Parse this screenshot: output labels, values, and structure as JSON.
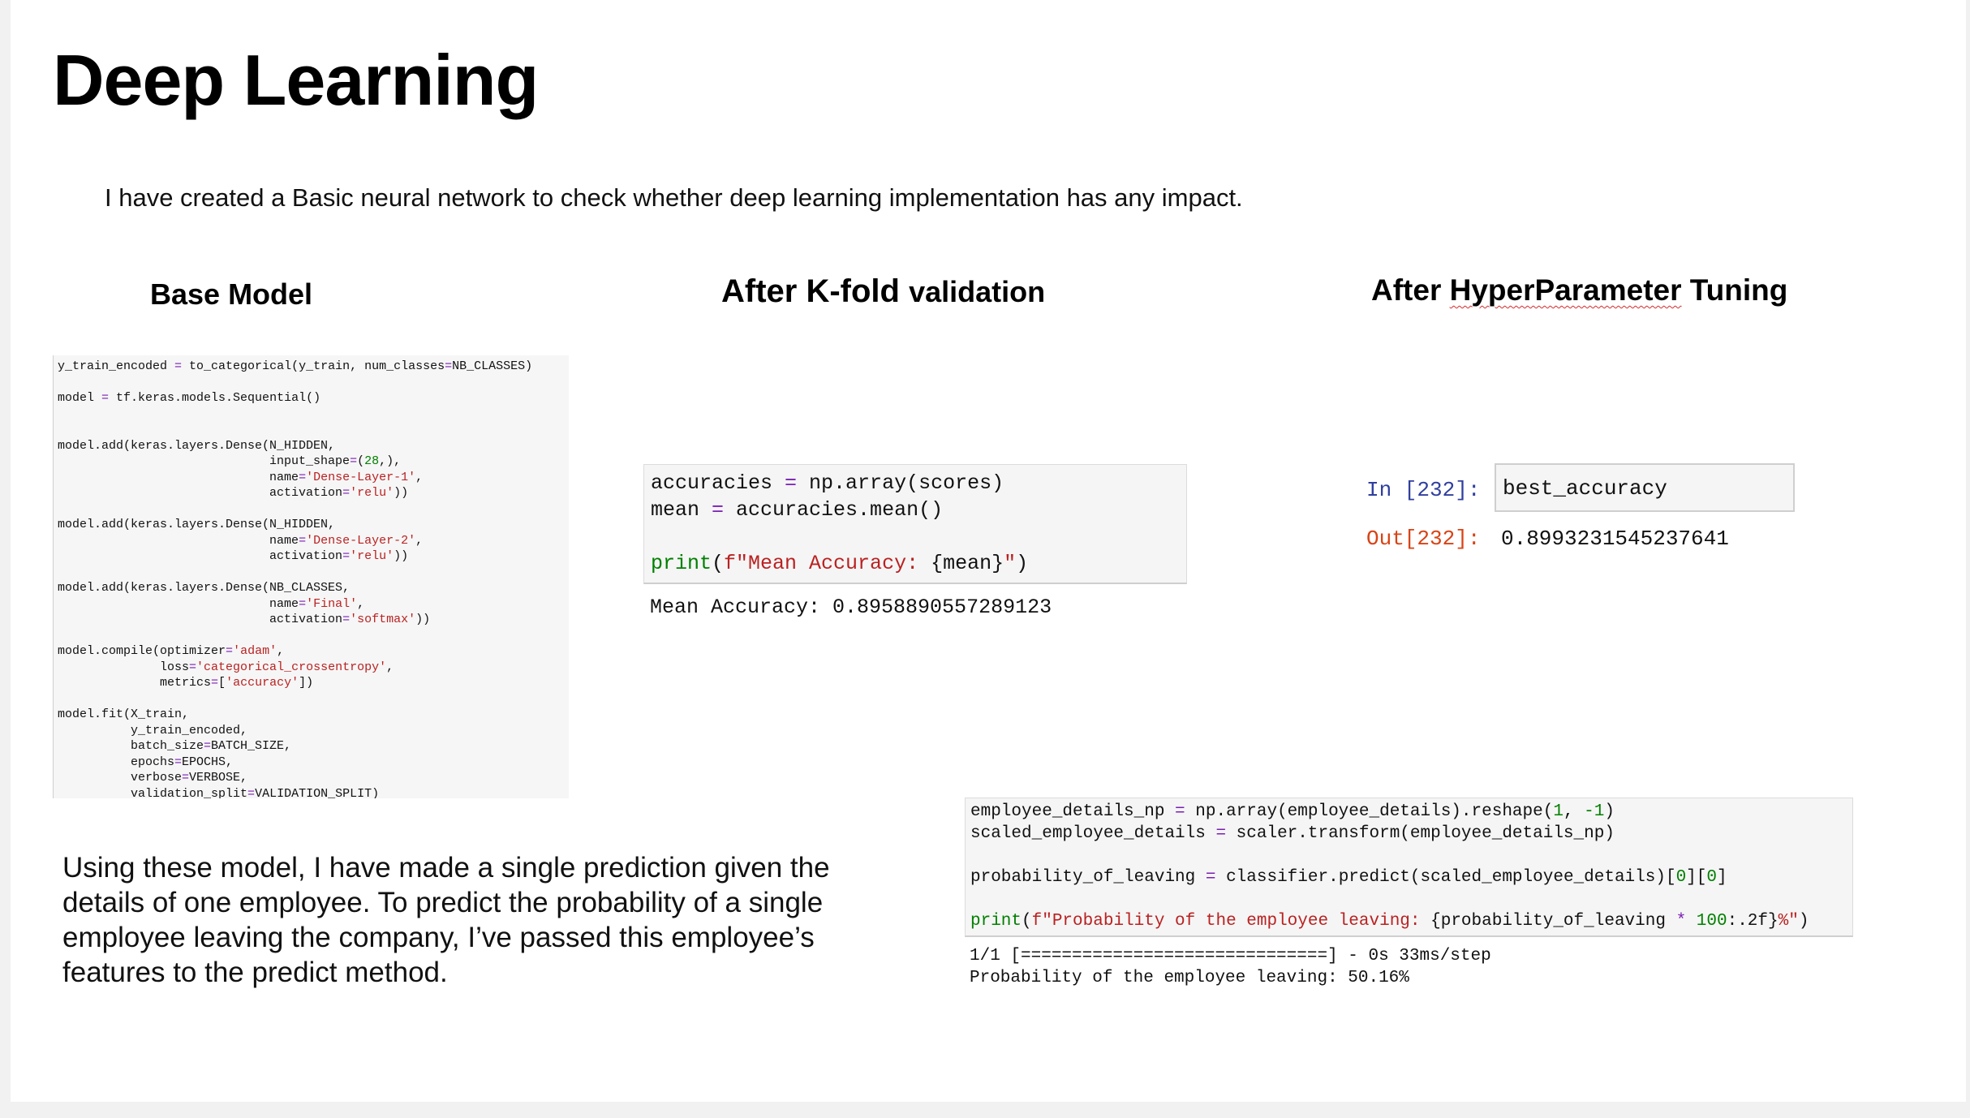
{
  "slide": {
    "title": "Deep Learning",
    "intro": "I have created a Basic neural network to check whether deep learning implementation has any impact.",
    "headings": {
      "base": "Base Model",
      "kfold_main": "After K-fold",
      "kfold_small": "validation",
      "hyper_pre": "After ",
      "hyper_squiggle": "HyperParameter",
      "hyper_post": " Tuning"
    },
    "prediction_text": "Using these model, I have made a single prediction given the details of one employee. To predict the probability of a single employee leaving the company, I’ve passed this employee’s features to the predict method."
  },
  "base_code": {
    "l1_a": "y_train_encoded ",
    "l1_eq": "=",
    "l1_b": " to_categorical(y_train, num_classes",
    "l1_eq2": "=",
    "l1_c": "NB_CLASSES)",
    "l2_a": "model ",
    "l2_eq": "=",
    "l2_b": " tf.keras.models.Sequential()",
    "l3": "model.add(keras.layers.Dense(N_HIDDEN,",
    "l4_a": "                             input_shape",
    "l4_eq": "=",
    "l4_b": "(",
    "l4_n": "28",
    "l4_c": ",),",
    "l5_a": "                             name",
    "l5_eq": "=",
    "l5_s": "'Dense-Layer-1'",
    "l5_c": ",",
    "l6_a": "                             activation",
    "l6_eq": "=",
    "l6_s": "'relu'",
    "l6_c": "))",
    "l7": "model.add(keras.layers.Dense(N_HIDDEN,",
    "l8_a": "                             name",
    "l8_eq": "=",
    "l8_s": "'Dense-Layer-2'",
    "l8_c": ",",
    "l9_a": "                             activation",
    "l9_eq": "=",
    "l9_s": "'relu'",
    "l9_c": "))",
    "l10": "model.add(keras.layers.Dense(NB_CLASSES,",
    "l11_a": "                             name",
    "l11_eq": "=",
    "l11_s": "'Final'",
    "l11_c": ",",
    "l12_a": "                             activation",
    "l12_eq": "=",
    "l12_s": "'softmax'",
    "l12_c": "))",
    "l13_a": "model.compile(optimizer",
    "l13_eq": "=",
    "l13_s": "'adam'",
    "l13_c": ",",
    "l14_a": "              loss",
    "l14_eq": "=",
    "l14_s": "'categorical_crossentropy'",
    "l14_c": ",",
    "l15_a": "              metrics",
    "l15_eq": "=",
    "l15_b": "[",
    "l15_s": "'accuracy'",
    "l15_c": "])",
    "l16": "model.fit(X_train,",
    "l17": "          y_train_encoded,",
    "l18_a": "          batch_size",
    "l18_eq": "=",
    "l18_b": "BATCH_SIZE,",
    "l19_a": "          epochs",
    "l19_eq": "=",
    "l19_b": "EPOCHS,",
    "l20_a": "          verbose",
    "l20_eq": "=",
    "l20_b": "VERBOSE,",
    "l21_a": "          validation_split",
    "l21_eq": "=",
    "l21_b": "VALIDATION_SPLIT)"
  },
  "kfold": {
    "l1_a": "accuracies ",
    "l1_eq": "=",
    "l1_b": " np.array(scores)",
    "l2_a": "mean ",
    "l2_eq": "=",
    "l2_b": " accuracies.mean()",
    "l3_fn": "print",
    "l3_p": "(",
    "l3_s": "f\"Mean Accuracy: ",
    "l3_v": "{mean}",
    "l3_s2": "\"",
    "l3_c": ")",
    "output": "Mean Accuracy: 0.8958890557289123"
  },
  "hyper": {
    "in_label": "In [232]:",
    "in_code": "best_accuracy",
    "out_label": "Out[232]:",
    "out_value": "0.8993231545237641"
  },
  "employee": {
    "l1_a": "employee_details_np ",
    "l1_eq": "=",
    "l1_b": " np.array(employee_details).reshape(",
    "l1_n1": "1",
    "l1_c": ", ",
    "l1_n2": "-1",
    "l1_d": ")",
    "l2_a": "scaled_employee_details ",
    "l2_eq": "=",
    "l2_b": " scaler.transform(employee_details_np)",
    "l3_a": "probability_of_leaving ",
    "l3_eq": "=",
    "l3_b": " classifier.predict(scaled_employee_details)[",
    "l3_n1": "0",
    "l3_c": "][",
    "l3_n2": "0",
    "l3_d": "]",
    "l4_fn": "print",
    "l4_p": "(",
    "l4_s": "f\"Probability of the employee leaving: ",
    "l4_v": "{probability_of_leaving ",
    "l4_op": "*",
    "l4_sp": " ",
    "l4_n": "100",
    "l4_v2": ":.2f}",
    "l4_pct": "%",
    "l4_s2": "\"",
    "l4_c": ")",
    "out1": "1/1 [==============================] - 0s 33ms/step",
    "out2": "Probability of the employee leaving: 50.16%"
  }
}
